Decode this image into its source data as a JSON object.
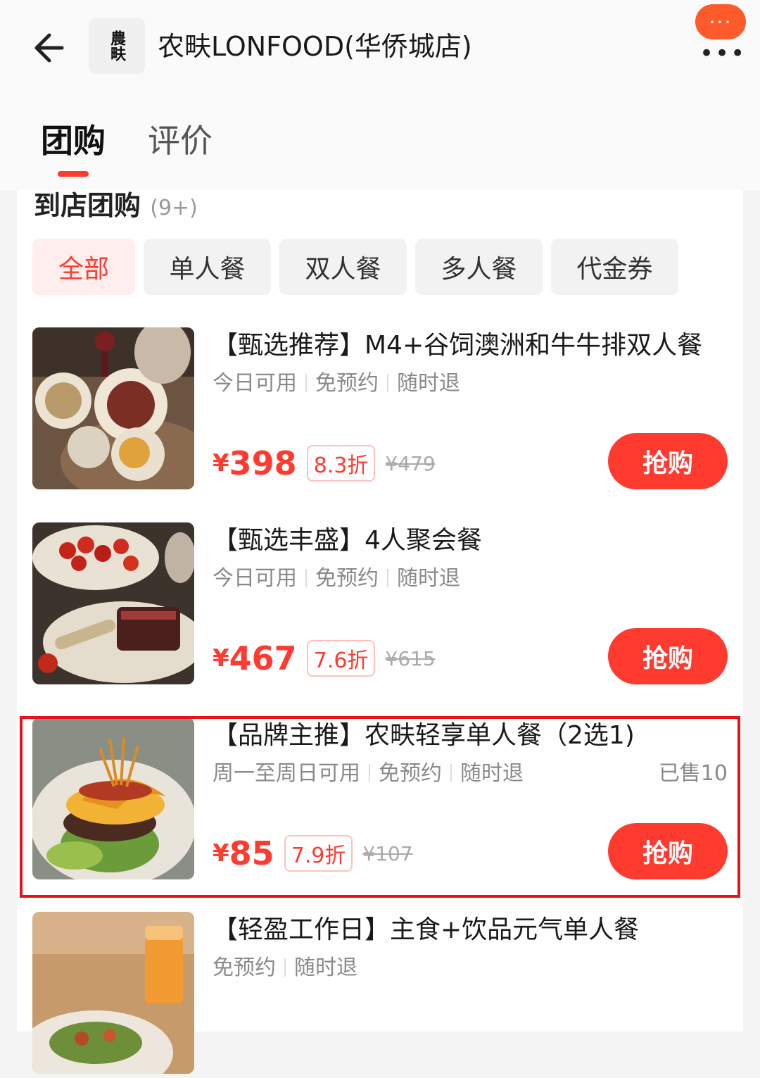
{
  "header": {
    "shop_name": "农畉LONFOOD(华侨城店)",
    "logo_text": "農畉",
    "more_label": "···",
    "dots_label": "•••"
  },
  "tabs": [
    {
      "label": "团购",
      "active": true
    },
    {
      "label": "评价",
      "active": false
    }
  ],
  "section": {
    "title": "到店团购",
    "count": "(9+)"
  },
  "filters": [
    {
      "label": "全部",
      "active": true
    },
    {
      "label": "单人餐"
    },
    {
      "label": "双人餐"
    },
    {
      "label": "多人餐"
    },
    {
      "label": "代金券"
    }
  ],
  "deals": [
    {
      "title": "【甄选推荐】M4+谷饲澳洲和牛牛排双人餐",
      "tags": [
        "今日可用",
        "免预约",
        "随时退"
      ],
      "sold": "",
      "yen": "¥",
      "price": "398",
      "discount": "8.3折",
      "original": "¥479",
      "buy_label": "抢购"
    },
    {
      "title": "【甄选丰盛】4人聚会餐",
      "tags": [
        "今日可用",
        "免预约",
        "随时退"
      ],
      "sold": "",
      "yen": "¥",
      "price": "467",
      "discount": "7.6折",
      "original": "¥615",
      "buy_label": "抢购"
    },
    {
      "title": "【品牌主推】农畉轻享单人餐（2选1)",
      "tags": [
        "周一至周日可用",
        "免预约",
        "随时退"
      ],
      "sold": "已售10",
      "yen": "¥",
      "price": "85",
      "discount": "7.9折",
      "original": "¥107",
      "buy_label": "抢购"
    },
    {
      "title": "【轻盈工作日】主食+饮品元气单人餐",
      "tags": [
        "免预约",
        "随时退"
      ],
      "sold": "",
      "yen": "",
      "price": "",
      "discount": "",
      "original": "",
      "buy_label": ""
    }
  ],
  "colors": {
    "accent": "#ff3b30",
    "highlight_border": "#e8101a",
    "more_button": "#ff5a2a"
  }
}
